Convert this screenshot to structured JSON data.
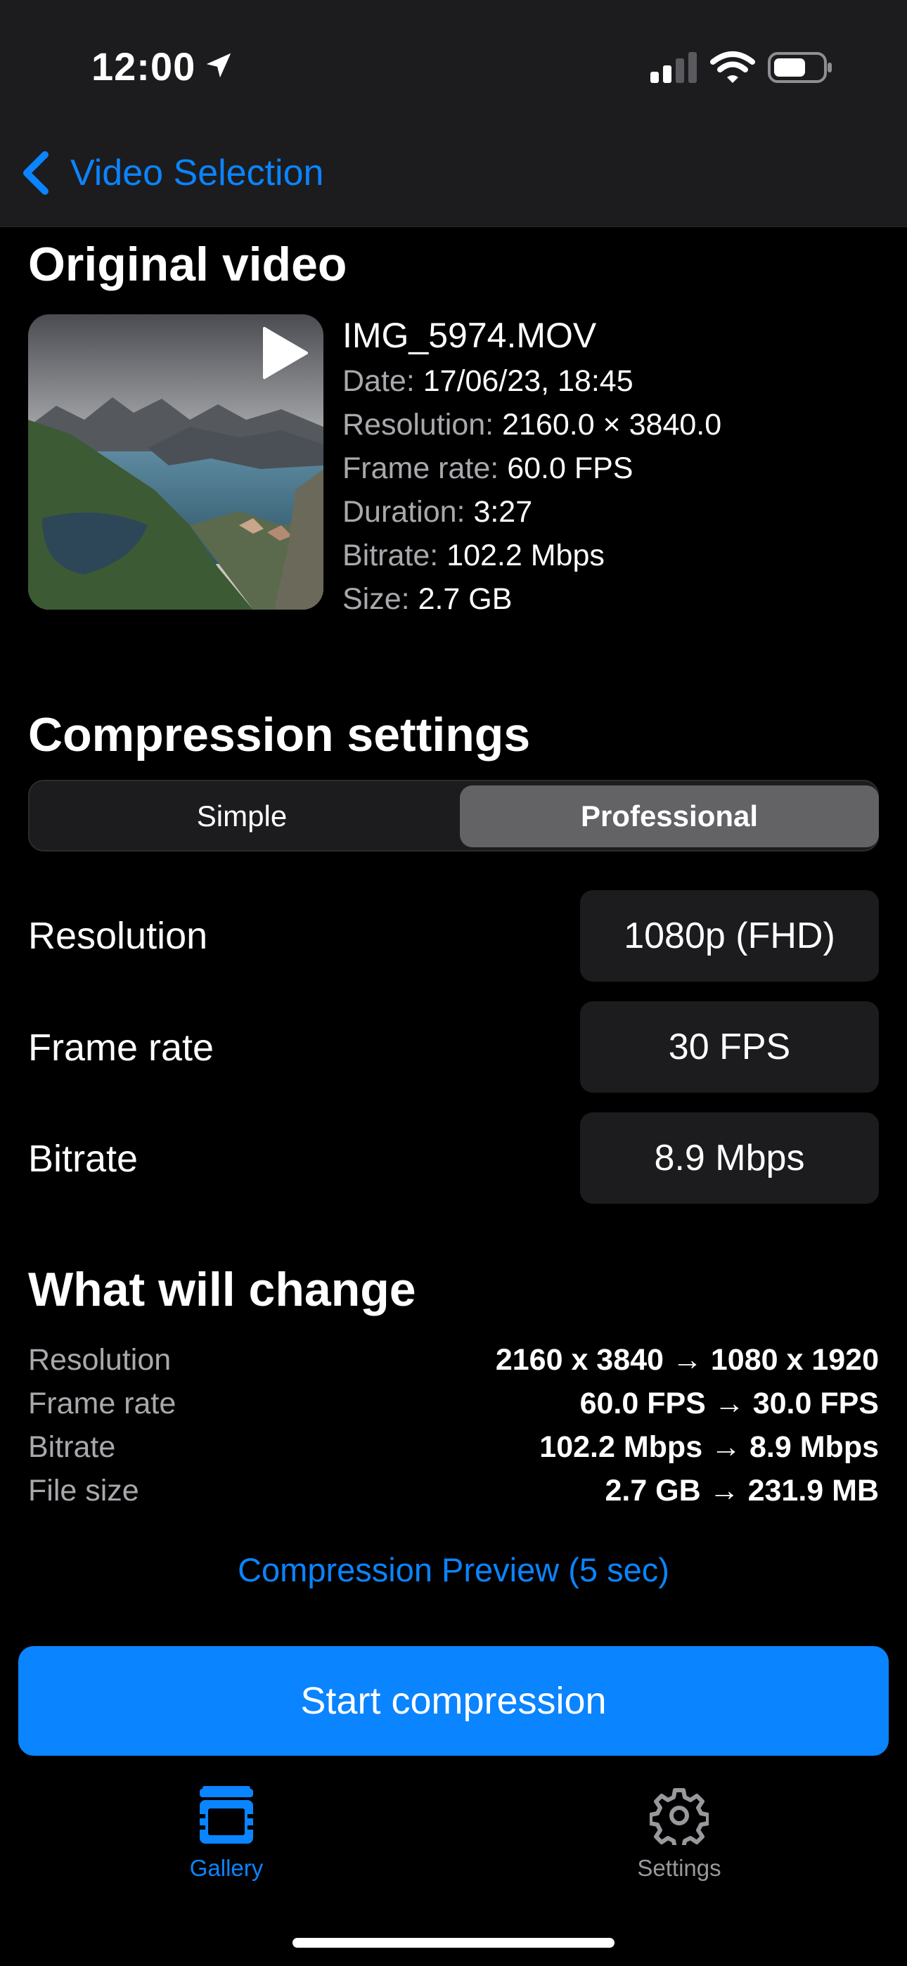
{
  "status_bar": {
    "time": "12:00"
  },
  "nav": {
    "back_label": "Video Selection"
  },
  "original": {
    "section_title": "Original video",
    "filename": "IMG_5974.MOV",
    "meta": [
      {
        "label": "Date:",
        "value": "17/06/23, 18:45"
      },
      {
        "label": "Resolution:",
        "value": "2160.0 × 3840.0"
      },
      {
        "label": "Frame rate:",
        "value": "60.0 FPS"
      },
      {
        "label": "Duration:",
        "value": "3:27"
      },
      {
        "label": "Bitrate:",
        "value": "102.2 Mbps"
      },
      {
        "label": "Size:",
        "value": "2.7 GB"
      }
    ]
  },
  "compression": {
    "section_title": "Compression settings",
    "segments": [
      "Simple",
      "Professional"
    ],
    "selected_segment": "Professional",
    "rows": [
      {
        "label": "Resolution",
        "value": "1080p (FHD)"
      },
      {
        "label": "Frame rate",
        "value": "30 FPS"
      },
      {
        "label": "Bitrate",
        "value": "8.9 Mbps"
      }
    ]
  },
  "changes": {
    "section_title": "What will change",
    "rows": [
      {
        "label": "Resolution",
        "value": "2160 x 3840 → 1080 x 1920"
      },
      {
        "label": "Frame rate",
        "value": "60.0 FPS → 30.0 FPS"
      },
      {
        "label": "Bitrate",
        "value": "102.2 Mbps → 8.9 Mbps"
      },
      {
        "label": "File size",
        "value": "2.7 GB → 231.9 MB"
      }
    ]
  },
  "actions": {
    "preview_label": "Compression Preview (5 sec)",
    "start_label": "Start compression"
  },
  "tabbar": {
    "tabs": [
      {
        "label": "Gallery",
        "icon": "film-icon",
        "active": true
      },
      {
        "label": "Settings",
        "icon": "gear-icon",
        "active": false
      }
    ]
  },
  "colors": {
    "accent": "#0a84ff",
    "background": "#000000",
    "surface": "#1c1c1e"
  }
}
